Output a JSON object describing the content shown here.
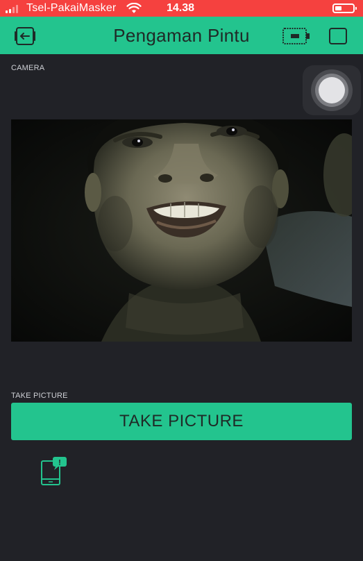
{
  "status_bar": {
    "carrier": "Tsel-PakaiMasker",
    "time": "14.38"
  },
  "header": {
    "title": "Pengaman Pintu",
    "icons": [
      "back-icon",
      "device-icon",
      "square-icon"
    ]
  },
  "camera_widget": {
    "label": "CAMERA"
  },
  "take_picture_widget": {
    "label": "TAKE PICTURE",
    "button_label": "TAKE PICTURE"
  },
  "notification_widget": {
    "badge": "!"
  },
  "colors": {
    "status_bar": "#f5413f",
    "accent": "#23c48e",
    "background": "#212227",
    "header_text": "#1f2a27"
  }
}
